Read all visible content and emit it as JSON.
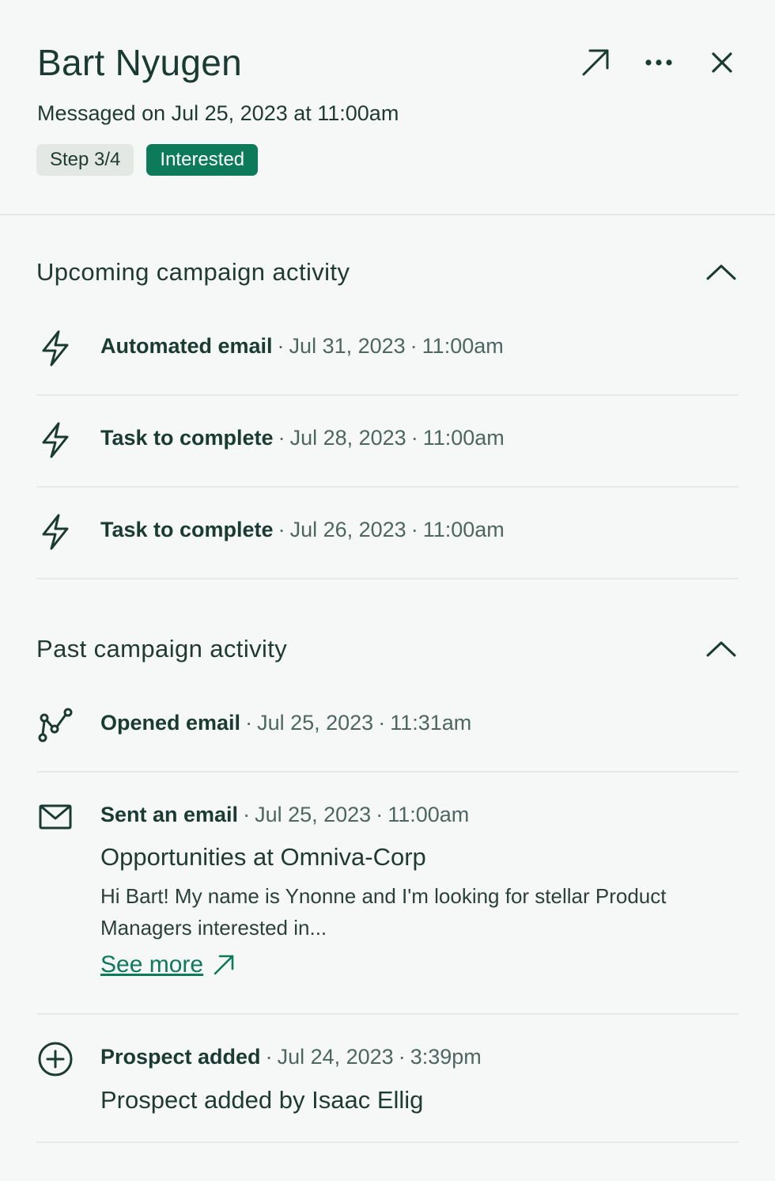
{
  "header": {
    "name": "Bart Nyugen",
    "messaged": "Messaged on Jul 25, 2023 at 11:00am",
    "badges": {
      "step": "Step 3/4",
      "status": "Interested"
    },
    "actions": [
      "open-external-icon",
      "more-icon",
      "close-icon"
    ]
  },
  "upcoming": {
    "title": "Upcoming campaign activity",
    "items": [
      {
        "kind": "Automated email",
        "date": "Jul 31, 2023",
        "time": "11:00am",
        "icon": "bolt-icon"
      },
      {
        "kind": "Task to complete",
        "date": "Jul 28, 2023",
        "time": "11:00am",
        "icon": "bolt-icon"
      },
      {
        "kind": "Task to complete",
        "date": "Jul 26, 2023",
        "time": "11:00am",
        "icon": "bolt-icon"
      }
    ]
  },
  "past": {
    "title": "Past campaign activity",
    "items": [
      {
        "kind": "Opened email",
        "date": "Jul 25, 2023",
        "time": "11:31am",
        "icon": "route-icon"
      },
      {
        "kind": "Sent an email",
        "date": "Jul 25, 2023",
        "time": "11:00am",
        "icon": "mail-icon",
        "subject": "Opportunities at Omniva-Corp",
        "snippet": "Hi Bart! My name is Ynonne and I'm looking for stellar Product Managers interested in...",
        "see_more": "See more"
      },
      {
        "kind": "Prospect added",
        "date": "Jul 24, 2023",
        "time": "3:39pm",
        "icon": "plus-circle-icon",
        "detail": "Prospect added by Isaac Ellig"
      }
    ]
  },
  "colors": {
    "accent": "#0d7a5a",
    "text": "#1f3a31",
    "muted": "#4d6660",
    "divider": "#e6e9e7",
    "background": "#f6f8f7"
  }
}
